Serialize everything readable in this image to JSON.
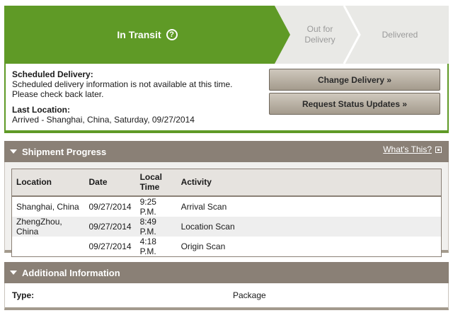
{
  "tracker": {
    "stages": [
      {
        "label": "In Transit",
        "state": "active"
      },
      {
        "label": "Out for Delivery",
        "state": "pending"
      },
      {
        "label": "Delivered",
        "state": "pending"
      }
    ],
    "help_icon": "?",
    "active_color": "#5f9a26"
  },
  "delivery": {
    "scheduled_label": "Scheduled Delivery:",
    "scheduled_text": "Scheduled delivery information is not available at this time. Please check back later.",
    "last_location_label": "Last Location:",
    "last_location_text": "Arrived - Shanghai, China, Saturday, 09/27/2014",
    "buttons": {
      "change": "Change Delivery »",
      "request": "Request Status Updates »"
    }
  },
  "shipment_progress": {
    "title": "Shipment Progress",
    "help_link": "What's This?",
    "columns": {
      "location": "Location",
      "date": "Date",
      "local_time": "Local Time",
      "activity": "Activity"
    },
    "rows": [
      {
        "location": "Shanghai, China",
        "date": "09/27/2014",
        "time": "9:25 P.M.",
        "activity": "Arrival Scan"
      },
      {
        "location": "ZhengZhou, China",
        "date": "09/27/2014",
        "time": "8:49 P.M.",
        "activity": "Location Scan"
      },
      {
        "location": "",
        "date": "09/27/2014",
        "time": "4:18 P.M.",
        "activity": "Origin Scan"
      }
    ]
  },
  "additional_info": {
    "title": "Additional Information",
    "type_label": "Type:",
    "type_value": "Package"
  },
  "colors": {
    "panel_header": "#8a8076",
    "button_top": "#cfc8bd",
    "button_bottom": "#a49b8d"
  }
}
